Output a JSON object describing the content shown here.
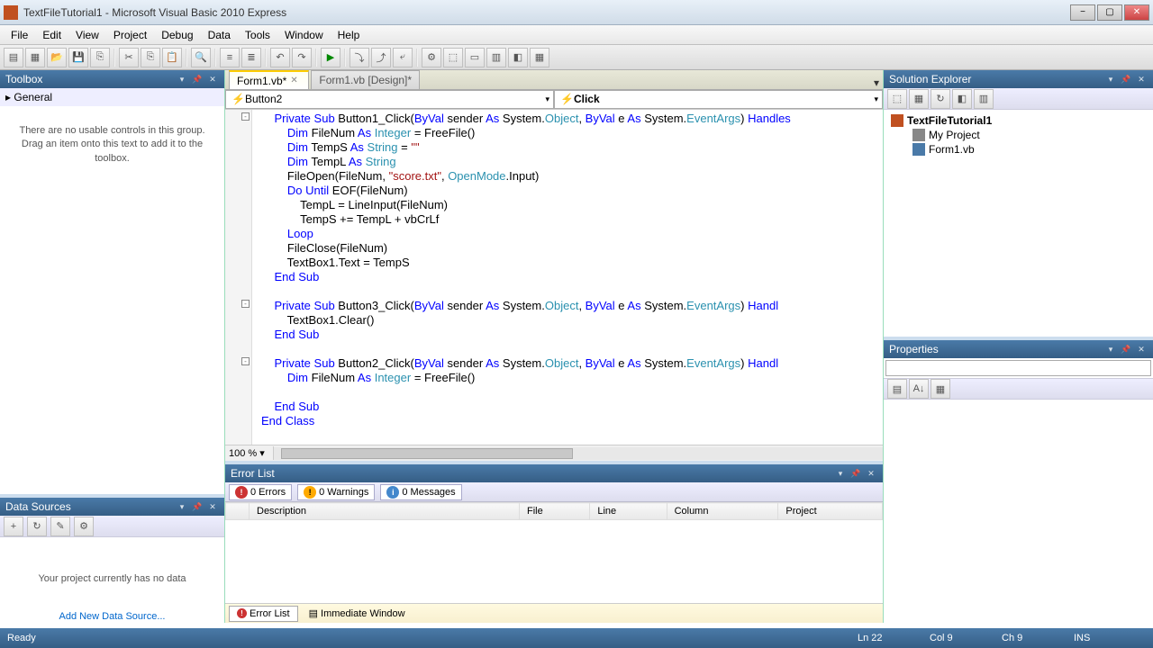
{
  "window": {
    "title": "TextFileTutorial1 - Microsoft Visual Basic 2010 Express"
  },
  "menu": [
    "File",
    "Edit",
    "View",
    "Project",
    "Debug",
    "Data",
    "Tools",
    "Window",
    "Help"
  ],
  "tabs": [
    {
      "label": "Form1.vb*",
      "active": true
    },
    {
      "label": "Form1.vb [Design]*",
      "active": false
    }
  ],
  "combo_left": "Button2",
  "combo_right": "Click",
  "code_lines": [
    {
      "t": "    Private Sub Button1_Click(ByVal sender As System.Object, ByVal e As System.EventArgs) Handles"
    },
    {
      "t": "        Dim FileNum As Integer = FreeFile()"
    },
    {
      "t": "        Dim TempS As String = \"\""
    },
    {
      "t": "        Dim TempL As String"
    },
    {
      "t": "        FileOpen(FileNum, \"score.txt\", OpenMode.Input)"
    },
    {
      "t": "        Do Until EOF(FileNum)"
    },
    {
      "t": "            TempL = LineInput(FileNum)"
    },
    {
      "t": "            TempS += TempL + vbCrLf"
    },
    {
      "t": "        Loop"
    },
    {
      "t": "        FileClose(FileNum)"
    },
    {
      "t": "        TextBox1.Text = TempS"
    },
    {
      "t": "    End Sub"
    },
    {
      "t": ""
    },
    {
      "t": "    Private Sub Button3_Click(ByVal sender As System.Object, ByVal e As System.EventArgs) Handl"
    },
    {
      "t": "        TextBox1.Clear()"
    },
    {
      "t": "    End Sub"
    },
    {
      "t": ""
    },
    {
      "t": "    Private Sub Button2_Click(ByVal sender As System.Object, ByVal e As System.EventArgs) Handl"
    },
    {
      "t": "        Dim FileNum As Integer = FreeFile()"
    },
    {
      "t": "        "
    },
    {
      "t": "    End Sub"
    },
    {
      "t": "End Class"
    }
  ],
  "zoom": "100 %",
  "toolbox": {
    "header": "Toolbox",
    "group": "General",
    "empty": "There are no usable controls in this group. Drag an item onto this text to add it to the toolbox."
  },
  "datasources": {
    "header": "Data Sources",
    "empty": "Your project currently has no data",
    "link": "Add New Data Source..."
  },
  "solution": {
    "header": "Solution Explorer",
    "project": "TextFileTutorial1",
    "items": [
      "My Project",
      "Form1.vb"
    ]
  },
  "properties": {
    "header": "Properties"
  },
  "errorlist": {
    "header": "Error List",
    "errors": "0 Errors",
    "warnings": "0 Warnings",
    "messages": "0 Messages",
    "cols": [
      "",
      "Description",
      "File",
      "Line",
      "Column",
      "Project"
    ],
    "bottom": [
      "Error List",
      "Immediate Window"
    ]
  },
  "status": {
    "ready": "Ready",
    "ln": "Ln 22",
    "col": "Col 9",
    "ch": "Ch 9",
    "ins": "INS"
  }
}
